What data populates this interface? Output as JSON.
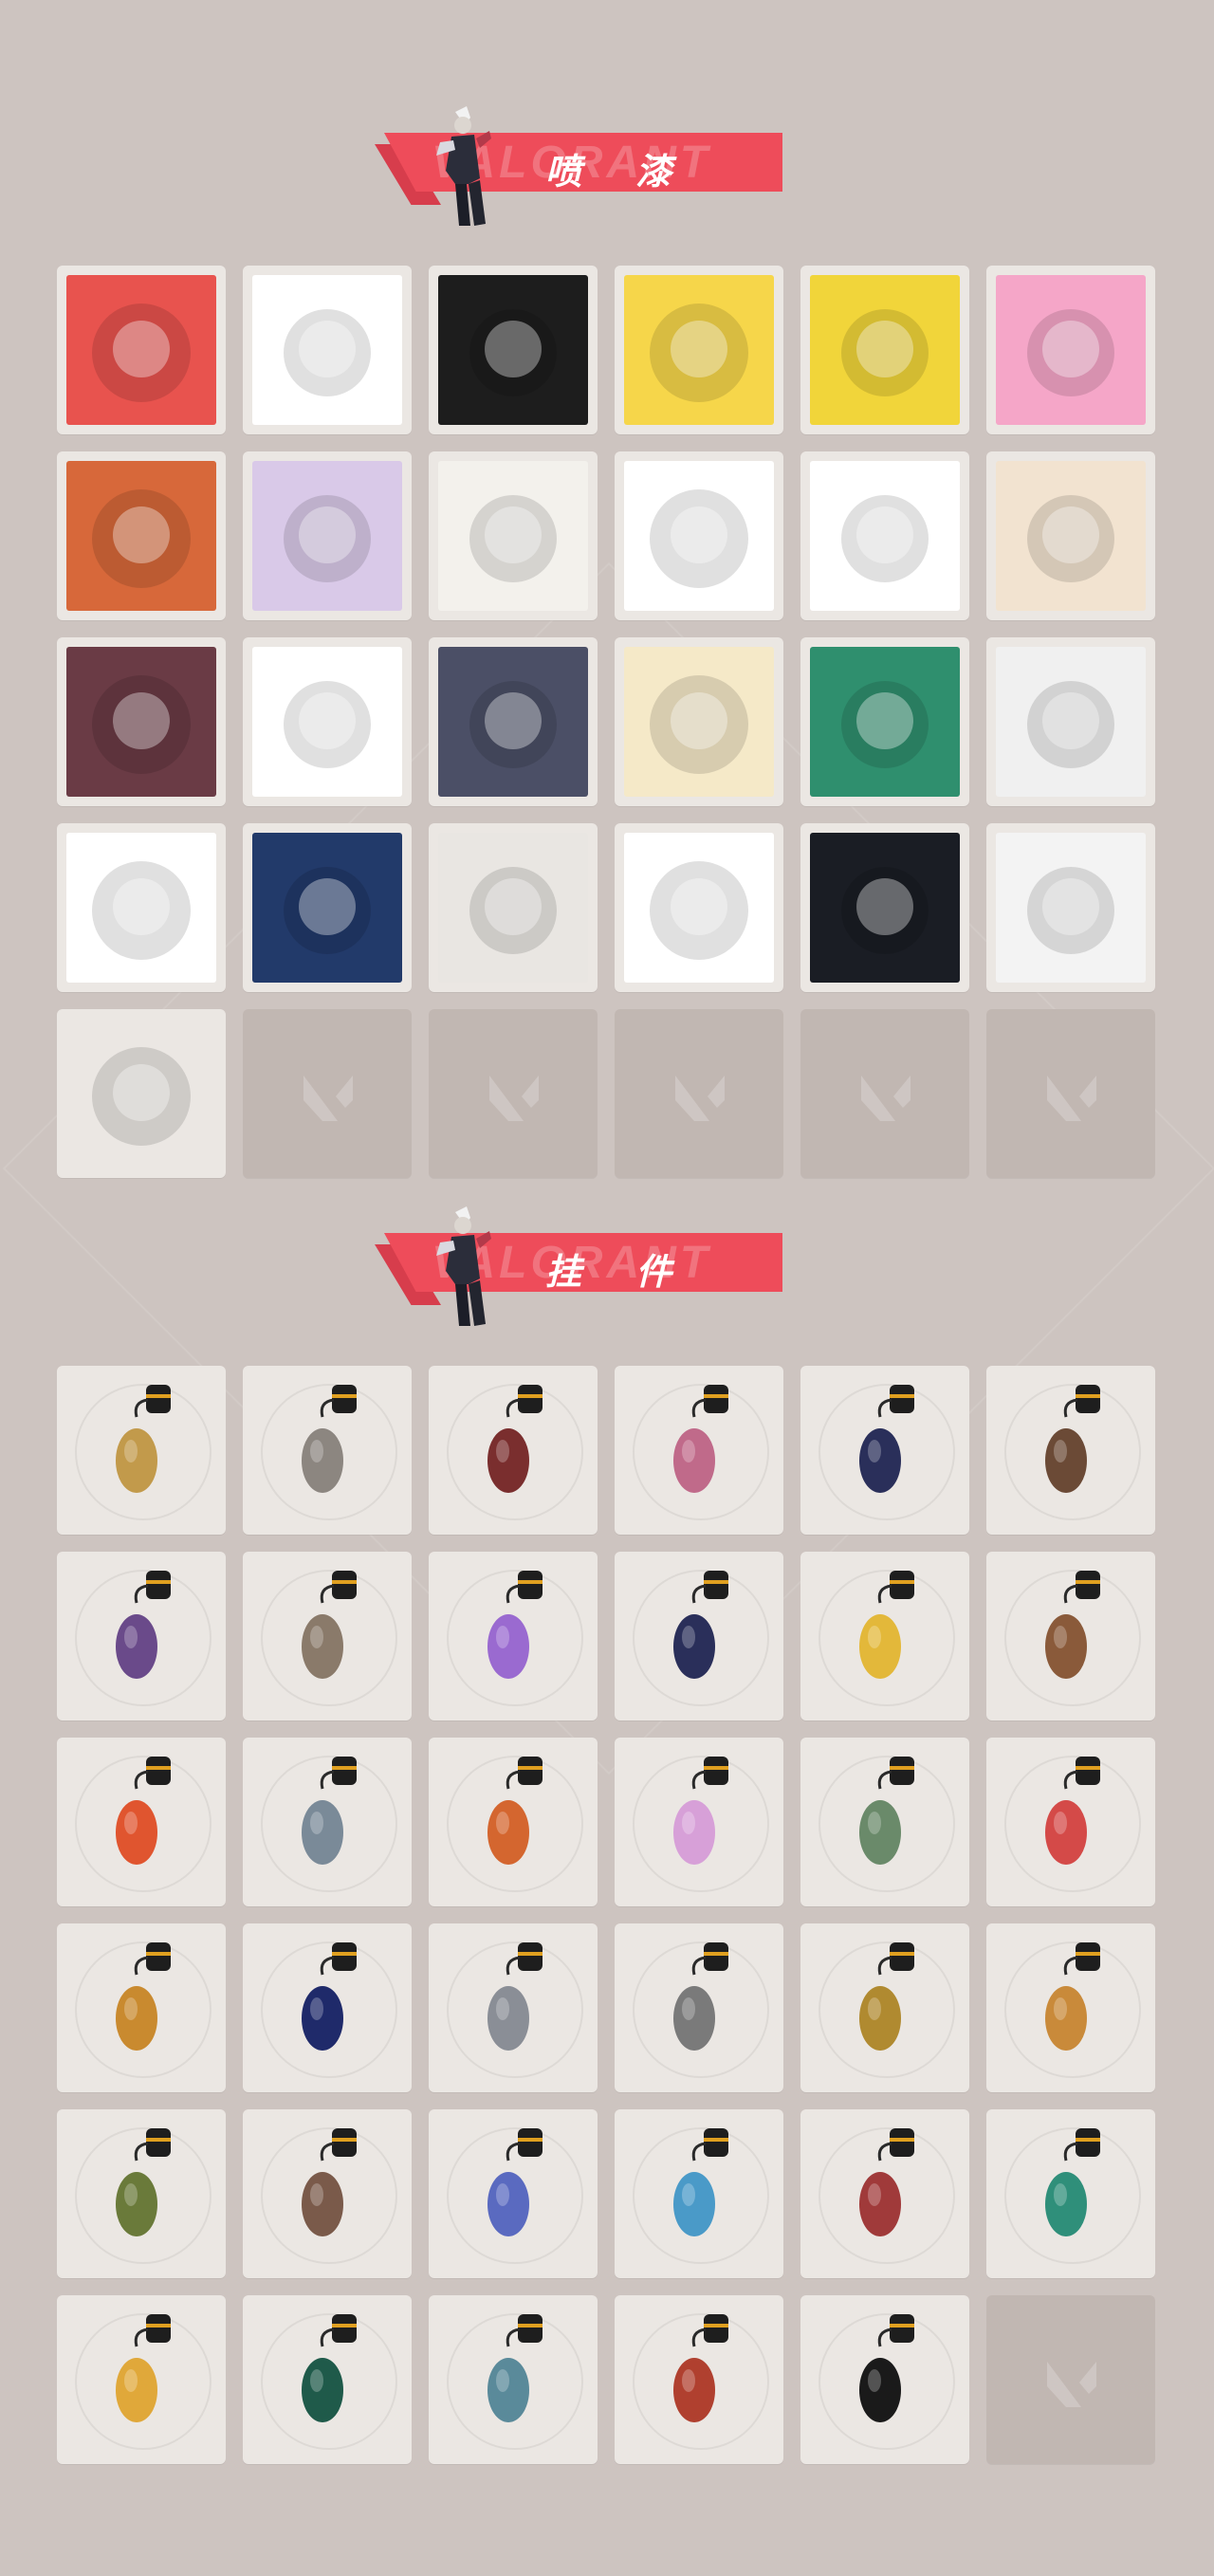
{
  "sections": {
    "sprays": {
      "title": "喷 漆",
      "ghost": "VALORANT",
      "items": [
        {
          "icon": "bullet-number-10-spray",
          "bg": "#e8534e"
        },
        {
          "icon": "blue-orb-spray",
          "bg": "#ffffff"
        },
        {
          "icon": "yellow-creature-face-spray",
          "bg": "#1d1d1d"
        },
        {
          "icon": "bandana-bunny-spray",
          "bg": "#f6d64a"
        },
        {
          "icon": "grenades-pile-spray",
          "bg": "#f1d53a"
        },
        {
          "icon": "laughing-agent-green-hat-spray",
          "bg": "#f5a6c8"
        },
        {
          "icon": "laughing-agent-orange-hair-spray",
          "bg": "#d7683a"
        },
        {
          "icon": "yellow-chick-purple-hat-spray",
          "bg": "#d9c9e8"
        },
        {
          "icon": "masked-agent-number-01-spray",
          "bg": "#f3f1ec"
        },
        {
          "icon": "bearded-agent-laughing-spray",
          "bg": "#ffffff"
        },
        {
          "icon": "winking-agent-drink-spray",
          "bg": "#ffffff"
        },
        {
          "icon": "white-haired-agent-crying-spray",
          "bg": "#f2e3d0"
        },
        {
          "icon": "smug-agent-face-spray",
          "bg": "#6a3b45"
        },
        {
          "icon": "white-haired-agent-yelling-spray",
          "bg": "#ffffff"
        },
        {
          "icon": "blob-creature-tongue-spray",
          "bg": "#4b4f66"
        },
        {
          "icon": "blonde-agent-face-spray",
          "bg": "#f5e9c8"
        },
        {
          "icon": "gold-emerald-tile-spray",
          "bg": "#2f8f6e"
        },
        {
          "icon": "duck-helmet-spray",
          "bg": "#f0f0f0"
        },
        {
          "icon": "no-spray-sign-spray",
          "bg": "#ffffff"
        },
        {
          "icon": "golden-clouds-spray",
          "bg": "#223a6a"
        },
        {
          "icon": "red-x-button-spray",
          "bg": "#e9e6e2"
        },
        {
          "icon": "red-card-agent-spray",
          "bg": "#ffffff"
        },
        {
          "icon": "valorant-logo-splatter-spray",
          "bg": "#1a1d24"
        },
        {
          "icon": "graffiti-tag-spray",
          "bg": "#f3f3f3"
        },
        {
          "icon": "red-valorant-badge-spray",
          "bg": "#ebe7e3"
        }
      ],
      "empty_slots": 5
    },
    "charms": {
      "title": "挂 件",
      "ghost": "VALORANT",
      "items": [
        {
          "icon": "golden-tiger-charm",
          "color": "#c29a4b"
        },
        {
          "icon": "tech-box-charm",
          "color": "#8c8680"
        },
        {
          "icon": "braided-cord-charm",
          "color": "#7a2e2e"
        },
        {
          "icon": "cupcake-charm",
          "color": "#c06a8a"
        },
        {
          "icon": "ep9-medal-charm",
          "color": "#2a2f5a"
        },
        {
          "icon": "wooden-crate-charm",
          "color": "#6b4a36"
        },
        {
          "icon": "agent-figure-charm",
          "color": "#6a4a8a"
        },
        {
          "icon": "cowboy-robot-charm",
          "color": "#8a7a6a"
        },
        {
          "icon": "lava-lamp-charm",
          "color": "#9a6ad0"
        },
        {
          "icon": "ep9-medal-charm",
          "color": "#2a2f5a"
        },
        {
          "icon": "banana-cookie-charm",
          "color": "#e3b83a"
        },
        {
          "icon": "ice-pop-charm",
          "color": "#8a5a3a"
        },
        {
          "icon": "lantern-chain-charm",
          "color": "#e0552f"
        },
        {
          "icon": "agent-plaque-charm",
          "color": "#7a8a98"
        },
        {
          "icon": "hot-air-balloon-charm",
          "color": "#d4662f"
        },
        {
          "icon": "pink-hair-agent-charm",
          "color": "#d7a0d8"
        },
        {
          "icon": "robot-cart-charm",
          "color": "#6a8a6a"
        },
        {
          "icon": "watermelon-slice-charm",
          "color": "#d44a48"
        },
        {
          "icon": "beehive-charm",
          "color": "#c98a2f"
        },
        {
          "icon": "ep9-medal-charm",
          "color": "#1f2a6a"
        },
        {
          "icon": "silver-claw-charm",
          "color": "#8a8e96"
        },
        {
          "icon": "diamond-plaque-charm",
          "color": "#7a7a7a"
        },
        {
          "icon": "golden-mech-charm",
          "color": "#b08a30"
        },
        {
          "icon": "fox-plush-charm",
          "color": "#c98a3a"
        },
        {
          "icon": "green-creature-charm",
          "color": "#6a7a3a"
        },
        {
          "icon": "raccoon-charm",
          "color": "#7a5a4a"
        },
        {
          "icon": "mecha-robot-charm",
          "color": "#5a6ac0"
        },
        {
          "icon": "blue-blade-charm",
          "color": "#4a9ac8"
        },
        {
          "icon": "red-creature-charm",
          "color": "#a03a3a"
        },
        {
          "icon": "green-diamond-charm",
          "color": "#2f8f7a"
        },
        {
          "icon": "sun-cloud-charm",
          "color": "#e0a83a"
        },
        {
          "icon": "ep8-medal-charm",
          "color": "#1f5a4a"
        },
        {
          "icon": "ufo-charm",
          "color": "#5a8a9a"
        },
        {
          "icon": "red-guitar-charm",
          "color": "#b0402f"
        },
        {
          "icon": "valorant-tag-charm",
          "color": "#1a1a1a"
        }
      ],
      "empty_slots": 1
    }
  }
}
